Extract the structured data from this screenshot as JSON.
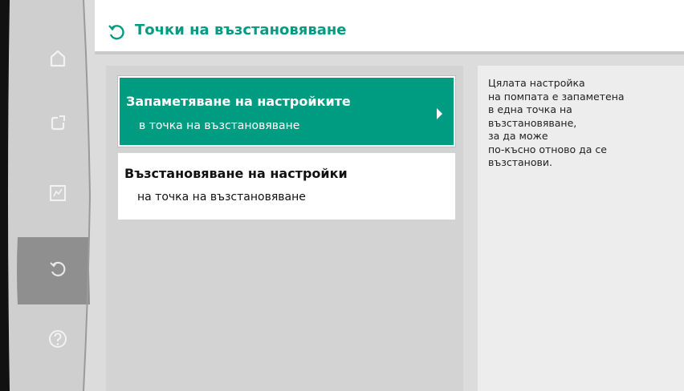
{
  "header": {
    "title": "Точки на възстановяване",
    "icon": "restore-icon"
  },
  "sidebar": {
    "items": [
      {
        "icon": "home-icon",
        "active": false
      },
      {
        "icon": "settings-icon",
        "active": false
      },
      {
        "icon": "diagnostics-icon",
        "active": false
      },
      {
        "icon": "restore-icon",
        "active": true
      },
      {
        "icon": "help-icon",
        "active": false
      }
    ]
  },
  "menu": {
    "items": [
      {
        "title": "Запаметяване на настройките",
        "subtitle": "в точка на възстановяване",
        "selected": true
      },
      {
        "title": "Възстановяване на настройки",
        "subtitle": "на точка на възстановяване",
        "selected": false
      }
    ]
  },
  "info": {
    "text": "Цялата настройка\nна помпата е запаметена\nв една точка на\nвъзстановяване,\nза да може\nпо-късно отново да се\nвъзстанови."
  },
  "colors": {
    "accent": "#009c82",
    "active_rail": "#8f8f8f",
    "rail": "#cfcfcf"
  }
}
